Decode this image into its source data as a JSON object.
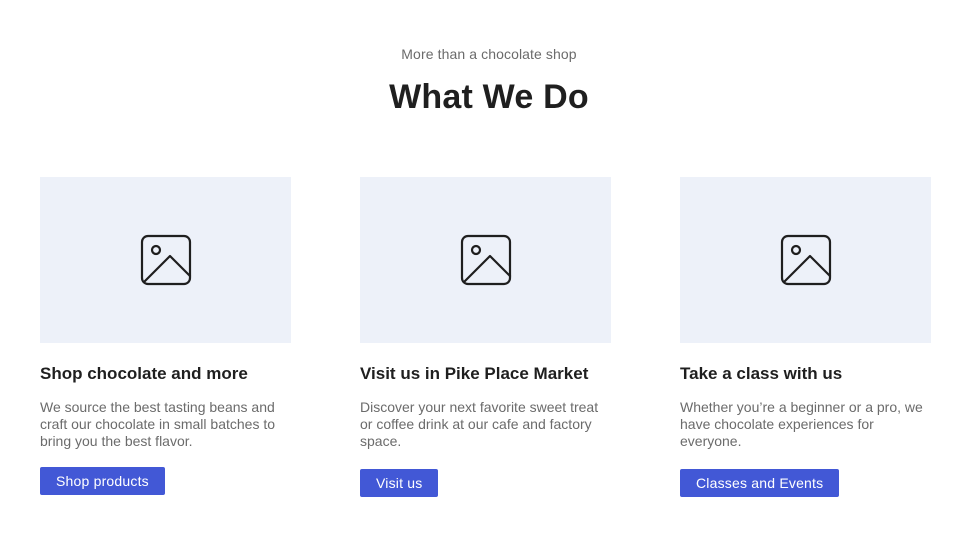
{
  "section": {
    "eyebrow": "More than a chocolate shop",
    "heading": "What We Do"
  },
  "cards": [
    {
      "icon": "image-placeholder-icon",
      "title": "Shop chocolate and more",
      "text": "We source the best tasting beans and craft our chocolate in small batches to bring you the best flavor.",
      "button_label": "Shop products"
    },
    {
      "icon": "image-placeholder-icon",
      "title": "Visit us in Pike Place Market",
      "text": "Discover your next favorite sweet treat or coffee drink at our cafe and factory space.",
      "button_label": "Visit us"
    },
    {
      "icon": "image-placeholder-icon",
      "title": "Take a class with us",
      "text": "Whether you’re a beginner or a pro, we have chocolate experiences for everyone.",
      "button_label": "Classes and Events"
    }
  ],
  "colors": {
    "accent": "#4258d6",
    "image_placeholder_bg": "#edf1f9",
    "heading_text": "#1f1f1f",
    "body_text": "#6b6b6b"
  }
}
